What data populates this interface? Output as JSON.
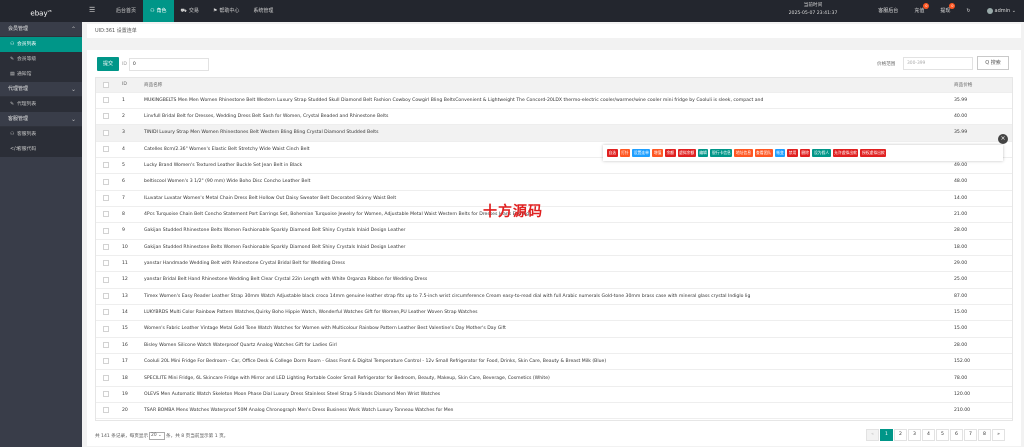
{
  "header": {
    "logo": "ebay",
    "logo_sup": "V8",
    "nav": [
      {
        "label": "后台首页",
        "icon": "",
        "active": false
      },
      {
        "label": "角色",
        "icon": "user-icon",
        "active": true
      },
      {
        "label": "交易",
        "icon": "cart-icon",
        "active": false
      },
      {
        "label": "帮助中心",
        "icon": "flag-icon",
        "active": false
      },
      {
        "label": "系统管理",
        "icon": "",
        "active": false
      }
    ],
    "time_label": "当前时间",
    "time_value": "2025-05-07 23:41:37",
    "right": [
      {
        "label": "客服后台",
        "badge": ""
      },
      {
        "label": "充值",
        "badge": "0"
      },
      {
        "label": "提现",
        "badge": "0"
      },
      {
        "label": "↻",
        "badge": ""
      },
      {
        "label": "admin ⌄",
        "badge": ""
      }
    ]
  },
  "sidebar": [
    {
      "type": "group",
      "label": "会员管理"
    },
    {
      "type": "item",
      "label": "会员列表",
      "icon": "user-icon",
      "active": true
    },
    {
      "type": "item",
      "label": "会员等级",
      "icon": "wrench-icon",
      "active": false
    },
    {
      "type": "item",
      "label": "通知馆",
      "icon": "list-icon",
      "active": false
    },
    {
      "type": "group",
      "label": "代理管理"
    },
    {
      "type": "item",
      "label": "代理列表",
      "icon": "wrench-icon",
      "active": false
    },
    {
      "type": "group",
      "label": "客服管理"
    },
    {
      "type": "item",
      "label": "客服列表",
      "icon": "users-icon",
      "active": false
    },
    {
      "type": "item",
      "label": "客服代码",
      "icon": "code-icon",
      "active": false
    }
  ],
  "breadcrumb": "UID:361 设置连单",
  "toolbar": {
    "submit_label": "提交",
    "id_label": "ID",
    "id_value": "0",
    "price_label": "价格范围",
    "price_placeholder": "300-399",
    "search_label": "Q 搜索"
  },
  "table": {
    "headers": [
      "",
      "ID",
      "商品名称",
      "商品价格"
    ],
    "rows": [
      {
        "id": "1",
        "name": "MUKINGBELTS Men Men Women Rhinestone Belt Western Luxury Strap Studded Skull Diamond Belt Fashion Cowboy Cowgirl Bling BeltsConvenient & Lightweight The Concord-20LDX thermo-electric cooler/warmer/wine cooler mini fridge by Cooluli is sleek, compact and",
        "price": "35.99"
      },
      {
        "id": "2",
        "name": "Linvfull Bridal Belt for Dresses, Wedding Dress Belt Sash for Women, Crystal Beaded and Rhinestone Belts",
        "price": "40.00"
      },
      {
        "id": "3",
        "name": "TINIDI Luxury Strap Men Women Rhinestones Belt Western Bling Bling Crystal Diamond Studded Belts",
        "price": "35.99"
      },
      {
        "id": "4",
        "name": "Catelles 8cm/2.36\" Women's Elastic Belt Stretchy Wide Waist Cinch Belt",
        "price": ""
      },
      {
        "id": "5",
        "name": "Lucky Brand Women's Textured Leather Buckle Set Jean Belt in Black",
        "price": "49.00"
      },
      {
        "id": "6",
        "name": "beltiscool Women's 3 1/2\" (90 mm) Wide Boho Disc Concho Leather Belt",
        "price": "48.00"
      },
      {
        "id": "7",
        "name": "ILuvatar Luvatar Women's Metal Chain Dress Belt Hollow Out Daisy Sweater Belt Decorated Skinny Waist Belt",
        "price": "14.00"
      },
      {
        "id": "8",
        "name": "4Pcs Turquoise Chain Belt Concho Statement Port Earrings Set, Bohemian Turquoise Jewelry for Women, Adjustable Metal Waist Western Belts for Dresses Jeans Earrings",
        "price": "21.00"
      },
      {
        "id": "9",
        "name": "Gakijan Studded Rhinestone Belts Women Fashionable Sparkly Diamond Belt Shiny Crystals Inlaid Design Leather",
        "price": "28.00"
      },
      {
        "id": "10",
        "name": "Gakijan Studded Rhinestone Belts Women Fashionable Sparkly Diamond Belt Shiny Crystals Inlaid Design Leather",
        "price": "18.00"
      },
      {
        "id": "11",
        "name": "yanstar Handmade Wedding Belt with Rhinestone Crystal Bridal Belt for Wedding Dress",
        "price": "29.00"
      },
      {
        "id": "12",
        "name": "yanstar Bridal Belt Hand Rhinestone Wedding Belt Clear Crystal 22in Length with White Organza Ribbon for Wedding Dress",
        "price": "25.00"
      },
      {
        "id": "13",
        "name": "Timex Women's Easy Reader Leather Strap 30mm Watch Adjustable black croco 14mm genuine leather strap fits up to 7.5-inch wrist circumference Cream easy-to-read dial with full Arabic numerals Gold-tone 30mm brass case with mineral glass crystal Indiglo lig",
        "price": "87.00"
      },
      {
        "id": "14",
        "name": "LUKYBRDS Multi Color Rainbow Pattern Watches,Quirky Boho Hippie Watch, Wonderful Watches Gift for Women,PU Leather Woven Strap Watches",
        "price": "15.00"
      },
      {
        "id": "15",
        "name": "Women's Fabric Leather Vintage Metal Gold Tone Watch Watches for Women with Multicolour Rainbow Pattern Leather Best Valentine's Day Mother's Day Gift",
        "price": "15.00"
      },
      {
        "id": "16",
        "name": "Bisley Women Silicone Watch Waterproof Quartz Analog Watches Gift for Ladies Girl",
        "price": "28.00"
      },
      {
        "id": "17",
        "name": "Cooluli 20L Mini Fridge For Bedroom - Car, Office Desk & College Dorm Room - Glass Front & Digital Temperature Control - 12v Small Refrigerator for Food, Drinks, Skin Care, Beauty & Breast Milk (Blue)",
        "price": "152.00"
      },
      {
        "id": "18",
        "name": "SPECILITE Mini Fridge, 6L Skincare Fridge with Mirror and LED Lighting Portable Cooler Small Refrigerator for Bedroom, Beauty, Makeup, Skin Care, Beverage, Cosmetics (White)",
        "price": "78.00"
      },
      {
        "id": "19",
        "name": "OLEVS Men Automatic Watch Skeleton Moon Phase Dial Luxury Dress Stainless Steel Strap 5 Hands Diamond Men Wrist Watches",
        "price": "120.00"
      },
      {
        "id": "20",
        "name": "TSAR BOMBA Mens Watches Waterproof 50M Analog Chronograph Men's Dress Business Work Watch Luxury Tonneau Watches for Men",
        "price": "210.00"
      }
    ]
  },
  "pager": {
    "total_text": "共 141 条记录，每页显示",
    "per_page": "20 ⌄",
    "pages_text": "条，共 8 页当前显示第 1 页。",
    "pages": [
      "«",
      "1",
      "2",
      "3",
      "4",
      "5",
      "6",
      "7",
      "8",
      "»"
    ],
    "current": "1"
  },
  "actionbar": {
    "actions": [
      {
        "label": "自选",
        "color": "#e02020"
      },
      {
        "label": "打针",
        "color": "#ff5722"
      },
      {
        "label": "设置连单",
        "color": "#1e9fff"
      },
      {
        "label": "增值",
        "color": "#ff5722"
      },
      {
        "label": "余额",
        "color": "#e02020"
      },
      {
        "label": "虚拟余额",
        "color": "#e02020"
      },
      {
        "label": "编辑",
        "color": "#009688"
      },
      {
        "label": "银行卡信息",
        "color": "#009688"
      },
      {
        "label": "地址信息",
        "color": "#ff5722"
      },
      {
        "label": "查看团队",
        "color": "#ff5722"
      },
      {
        "label": "帐变",
        "color": "#1e9fff"
      },
      {
        "label": "禁用",
        "color": "#e02020"
      },
      {
        "label": "删除",
        "color": "#e02020"
      },
      {
        "label": "设为假人",
        "color": "#009688"
      },
      {
        "label": "允许虚拟出款",
        "color": "#e02020"
      },
      {
        "label": "授权虚拟出款",
        "color": "#e02020"
      }
    ],
    "close": "×"
  },
  "watermark": "十方源码"
}
